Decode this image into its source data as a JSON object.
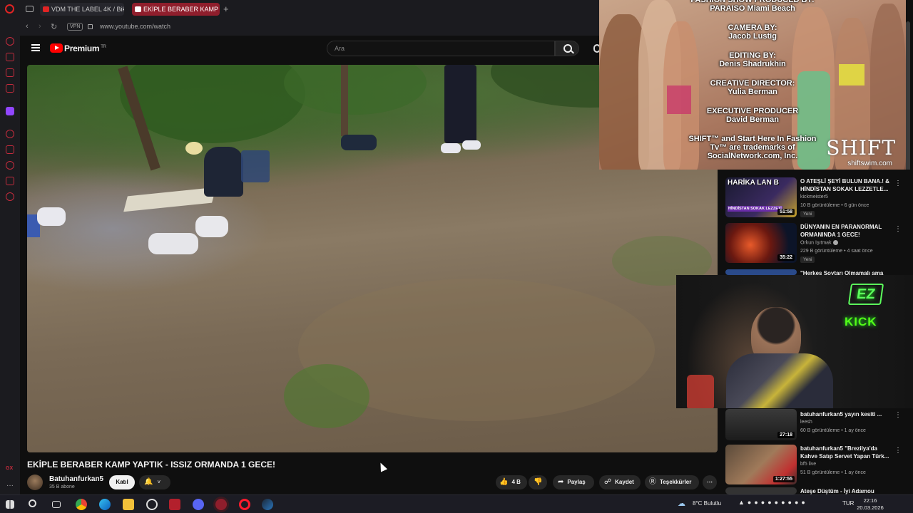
{
  "browser": {
    "tabs": [
      {
        "label": "VDM THE LABEL 4K / Biki"
      },
      {
        "label": "EKİPLE BERABER KAMP"
      }
    ],
    "new_tab_icon": "plus",
    "vpn_label": "VPN",
    "url": "www.youtube.com/watch"
  },
  "youtube": {
    "brand": "Premium",
    "brand_region": "TR",
    "search_placeholder": "Ara"
  },
  "video": {
    "title": "EKİPLE BERABER KAMP YAPTIK - ISSIZ ORMANDA 1 GECE!",
    "channel": "Batuhanfurkan5",
    "subscribers": "35 B abone",
    "join_label": "Katıl",
    "likes": "4 B",
    "share_label": "Paylaş",
    "save_label": "Kaydet",
    "thanks_label": "Teşekkürler",
    "more_icon": "more-horizontal"
  },
  "fashion_overlay": {
    "credits": [
      {
        "role": "FASHION SHOW PRODUCED BY:",
        "name": "PARAISO Miami Beach"
      },
      {
        "role": "CAMERA BY:",
        "name": "Jacob Lustig"
      },
      {
        "role": "EDITING BY:",
        "name": "Denis Shadrukhin"
      },
      {
        "role": "CREATIVE DIRECTOR:",
        "name": "Yulia Berman"
      },
      {
        "role": "EXECUTIVE PRODUCER",
        "name": "David Berman"
      },
      {
        "role": "SHIFT™ and Start Here In Fashion Tv™ are trademarks of",
        "name": "SocialNetwork.com, Inc."
      }
    ],
    "logo": "SHIFT",
    "logo_url": "shiftswim.com"
  },
  "recommendations": [
    {
      "title": "O ATEŞLİ ŞEYİ BULUN BANA.! & HİNDİSTAN SOKAK LEZZETLE...",
      "channel": "kickmeister5",
      "meta": "10 B görüntüleme • 6 gün önce",
      "badge": "Yeni",
      "duration": "51:58",
      "thumb_text": "HARİKA LAN B",
      "thumb_sub": "HİNDİSTAN SOKAK LEZZETİ"
    },
    {
      "title": "DÜNYANIN EN PARANORMAL ORMANINDA 1 GECE!",
      "channel": "Orkun Işıtmak",
      "meta": "229 B görüntüleme • 4 saat önce",
      "badge": "Yeni",
      "duration": "35:22"
    },
    {
      "title": "\"Herkes Soytarı Olmamalı ama",
      "channel": "",
      "meta": "",
      "badge": "",
      "duration": ""
    },
    {
      "title": "batuhanfurkan5 yayın kesiti ...",
      "channel": "leesh",
      "meta": "60 B görüntüleme • 1 ay önce",
      "badge": "",
      "duration": "27:18"
    },
    {
      "title": "batuhanfurkan5 \"Brezilya'da Kahve Satıp Servet Yapan Türk...",
      "channel": "bf5 live",
      "meta": "51 B görüntüleme • 1 ay önce",
      "badge": "",
      "duration": "1:27:55"
    },
    {
      "title": "Ateşe Düştüm - İyi Adamou",
      "channel": "",
      "meta": "",
      "badge": "",
      "duration": ""
    }
  ],
  "webcam": {
    "ez_logo": "EZ",
    "kick_label": "KICK"
  },
  "taskbar": {
    "weather": "8°C  Bulutlu",
    "language": "TUR",
    "time": "22:16",
    "date": "20.03.2026"
  },
  "colors": {
    "accent_red": "#ff0000",
    "opera_red": "#c62c3d",
    "kick_green": "#53fc18"
  }
}
